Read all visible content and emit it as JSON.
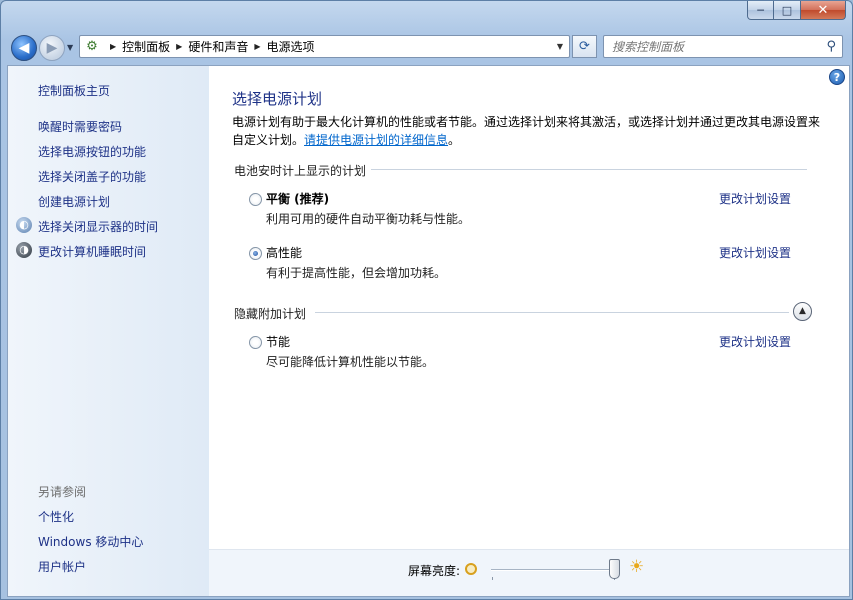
{
  "titlebar": {
    "minimize": "─",
    "maximize": "□",
    "close": "✕"
  },
  "nav": {
    "back_glyph": "◀",
    "forward_glyph": "▶",
    "breadcrumb": [
      "控制面板",
      "硬件和声音",
      "电源选项"
    ],
    "search_placeholder": "搜索控制面板"
  },
  "sidebar": {
    "home": "控制面板主页",
    "links": [
      "唤醒时需要密码",
      "选择电源按钮的功能",
      "选择关闭盖子的功能",
      "创建电源计划",
      "选择关闭显示器的时间",
      "更改计算机睡眠时间"
    ],
    "see_also_heading": "另请参阅",
    "see_also": [
      "个性化",
      "Windows 移动中心",
      "用户帐户"
    ]
  },
  "main": {
    "title": "选择电源计划",
    "intro_text": "电源计划有助于最大化计算机的性能或者节能。通过选择计划来将其激活，或选择计划并通过更改其电源设置来自定义计划。",
    "intro_link": "请提供电源计划的详细信息",
    "intro_end": "。",
    "group1_header": "电池安时计上显示的计划",
    "group2_header": "隐藏附加计划",
    "change_link": "更改计划设置",
    "plans": [
      {
        "name": "平衡 (推荐)",
        "desc": "利用可用的硬件自动平衡功耗与性能。",
        "selected": false
      },
      {
        "name": "高性能",
        "desc": "有利于提高性能，但会增加功耗。",
        "selected": true
      },
      {
        "name": "节能",
        "desc": "尽可能降低计算机性能以节能。",
        "selected": false
      }
    ]
  },
  "footer": {
    "brightness_label": "屏幕亮度:",
    "brightness_level": 1.0
  }
}
